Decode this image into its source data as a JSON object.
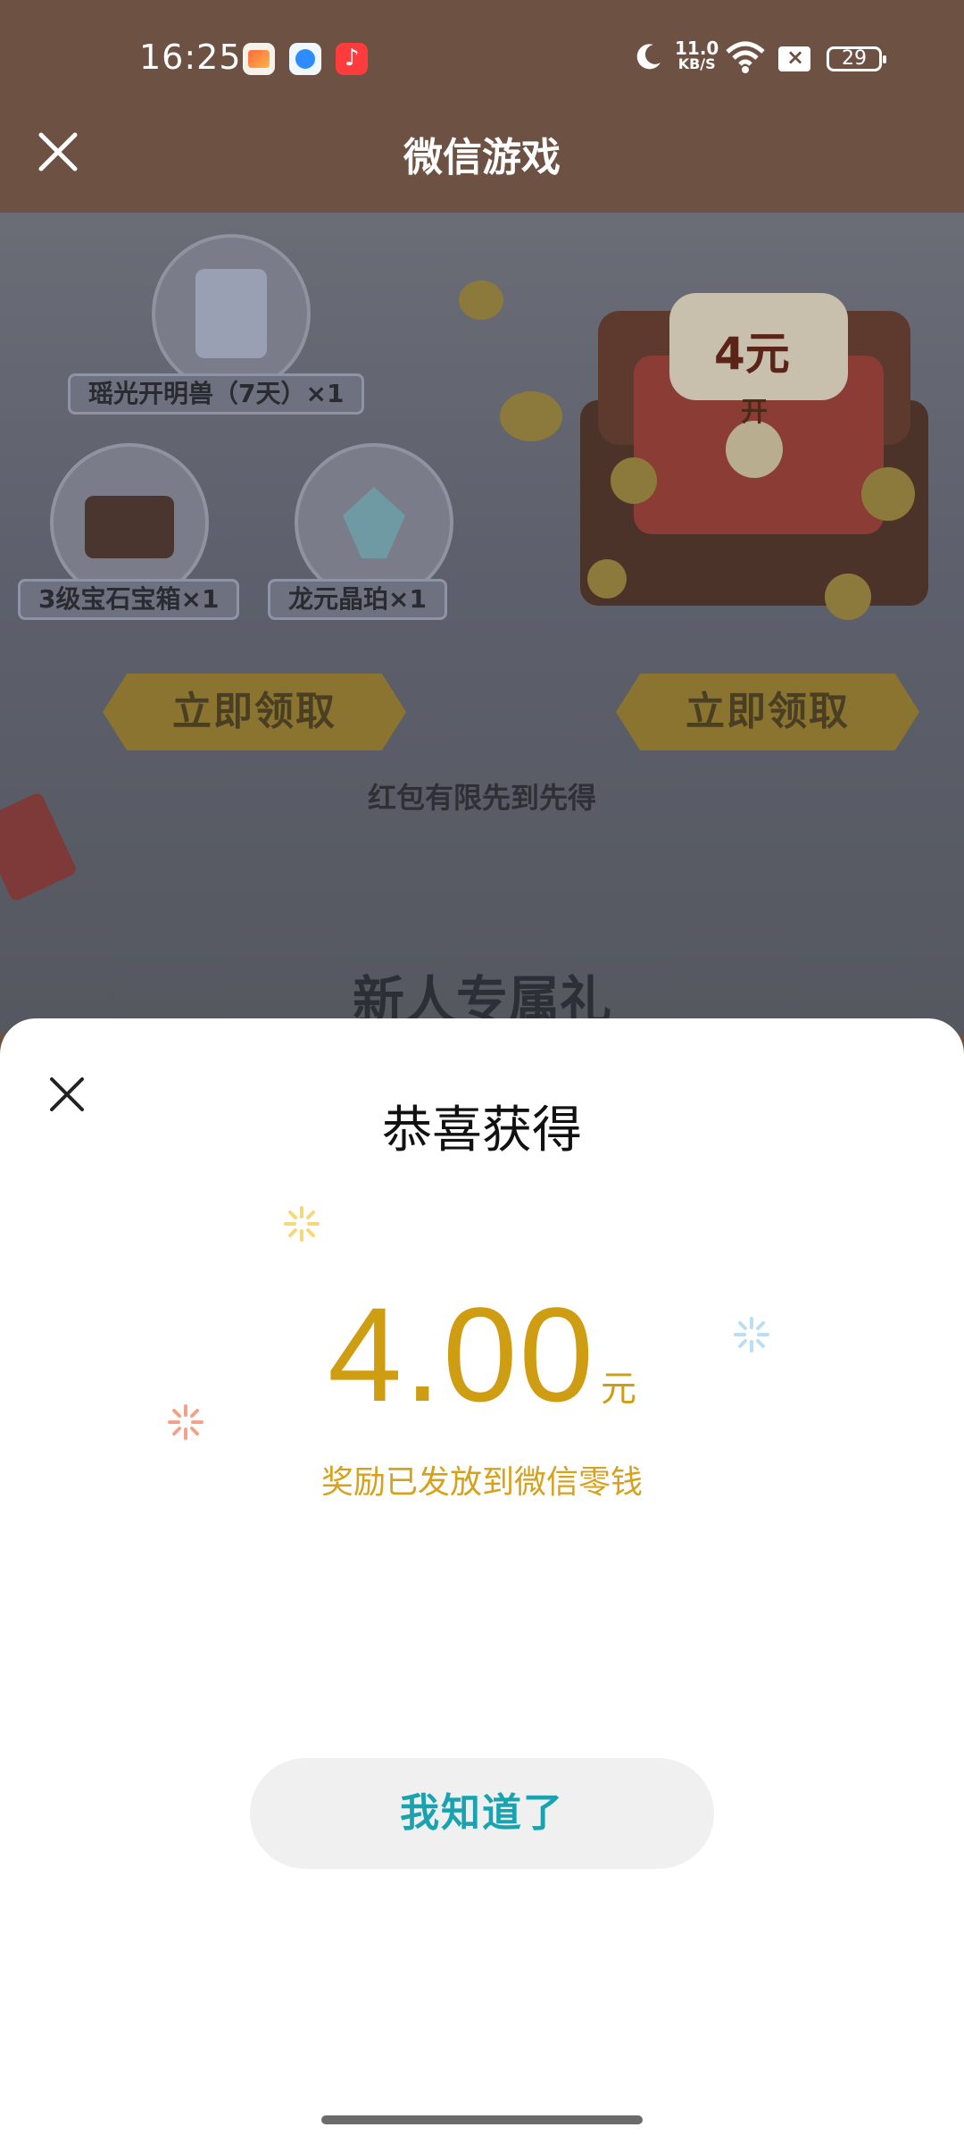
{
  "status_bar": {
    "time": "16:25",
    "net_speed_top": "11.0",
    "net_speed_bottom": "KB/S",
    "battery": "29"
  },
  "title_bar": {
    "title": "微信游戏"
  },
  "game_page": {
    "items": [
      {
        "label": "瑶光开明兽（7天）×1"
      },
      {
        "label": "3级宝石宝箱×1"
      },
      {
        "label": "龙元晶珀×1"
      }
    ],
    "chest_amount": "4元",
    "chest_open": "开",
    "claim_label": "立即领取",
    "note": "红包有限先到先得",
    "heading": "新人专属礼"
  },
  "sheet": {
    "title": "恭喜获得",
    "amount": "4.00",
    "unit": "元",
    "subtitle": "奖励已发放到微信零钱",
    "ok_label": "我知道了"
  },
  "colors": {
    "accent_gold": "#cf9d12",
    "button_text": "#19a3b0",
    "header": "#6d5142"
  }
}
